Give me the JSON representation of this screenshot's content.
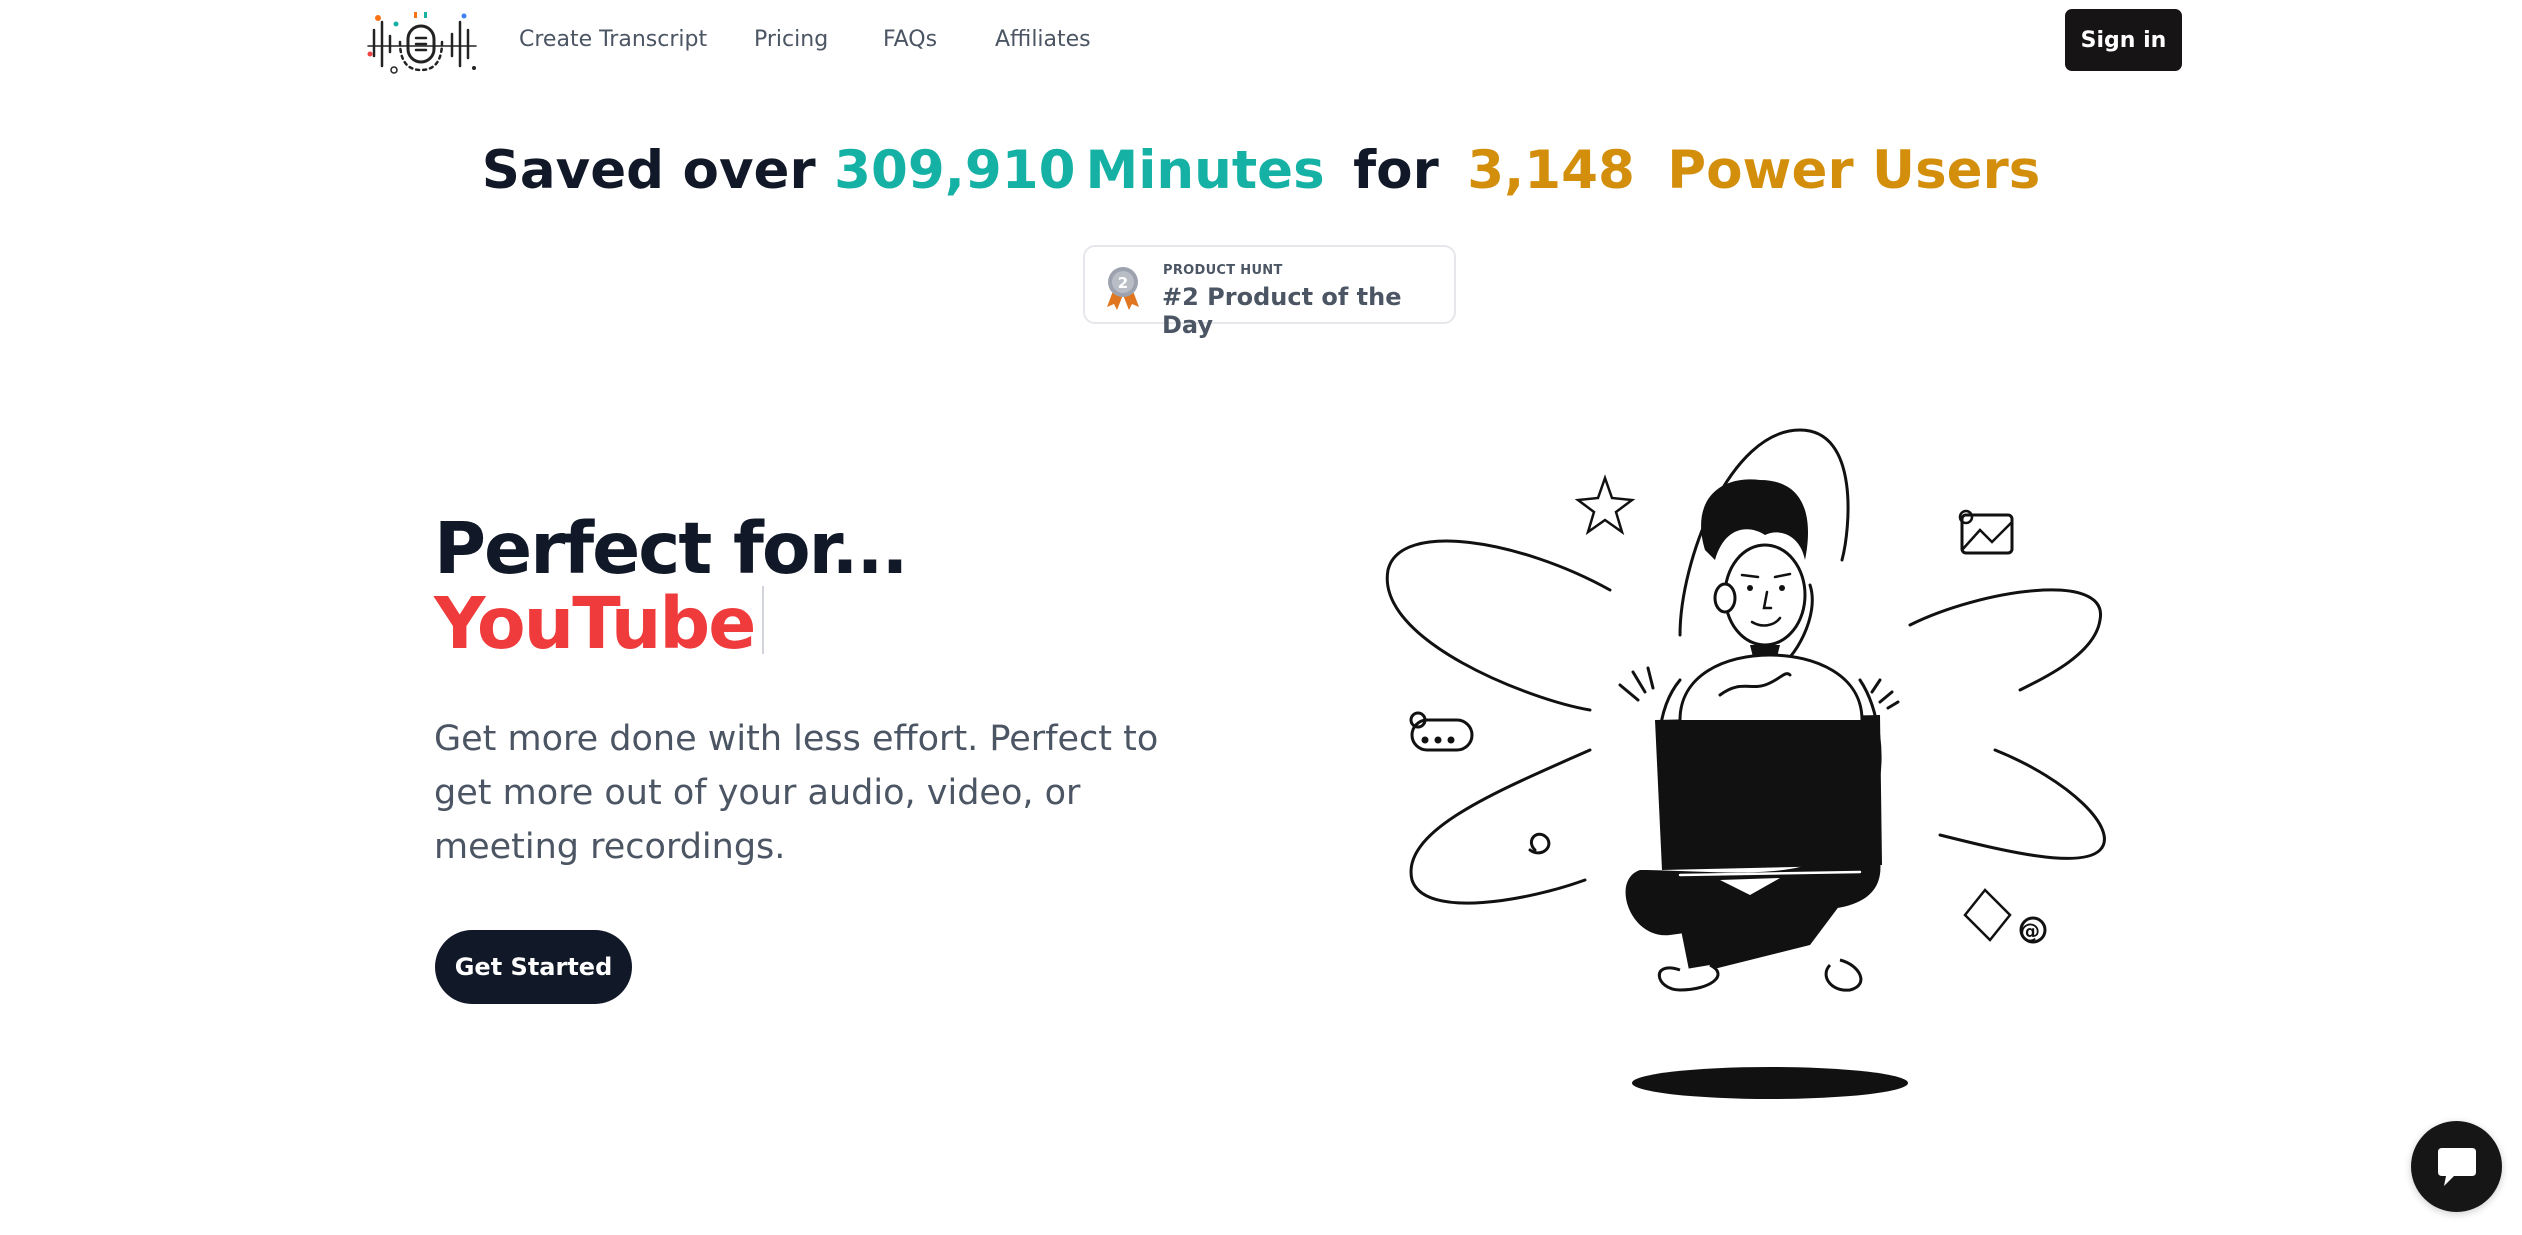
{
  "nav": {
    "links": [
      {
        "label": "Create Transcript"
      },
      {
        "label": "Pricing"
      },
      {
        "label": "FAQs"
      },
      {
        "label": "Affiliates"
      }
    ],
    "sign_in_label": "Sign in"
  },
  "stats": {
    "prefix": "Saved over",
    "minutes_count": "309,910",
    "minutes_label": "Minutes",
    "connector": "for",
    "users_count": "3,148",
    "users_label": "Power Users",
    "colors": {
      "teal": "#14b1a4",
      "gold": "#d38f0b"
    }
  },
  "badge": {
    "eyebrow": "PRODUCT HUNT",
    "title": "#2 Product of the Day",
    "medal_number": "2"
  },
  "hero": {
    "heading": "Perfect for...",
    "rotating_word": "YouTube",
    "rotating_color": "#ef3b3b",
    "body": "Get more done with less effort. Perfect to get more out of your audio, video, or meeting recordings.",
    "cta_label": "Get Started"
  },
  "icons": {
    "logo": "waveform-microphone-logo",
    "chat": "chat-bubble-icon",
    "medal": "medal-icon"
  }
}
